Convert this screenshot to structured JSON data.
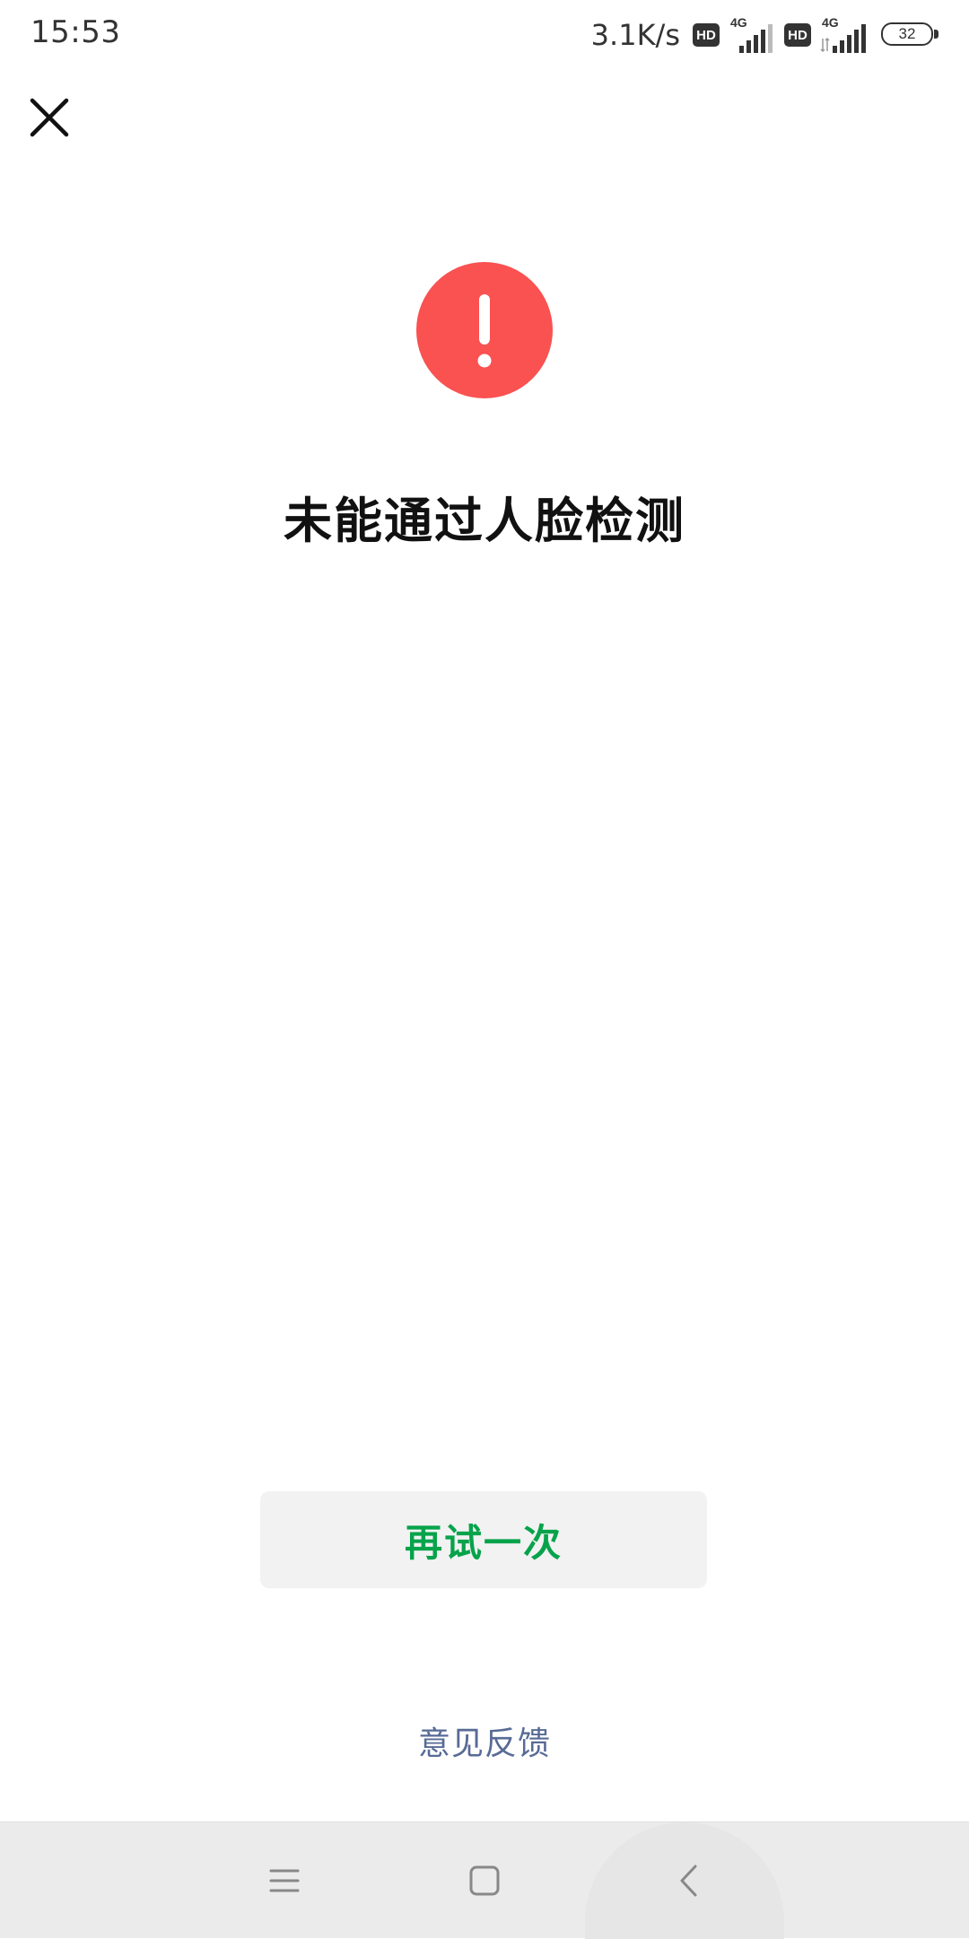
{
  "status_bar": {
    "time": "15:53",
    "net_speed": "3.1K/s",
    "hd_label": "HD",
    "network_label": "4G",
    "battery_level": "32"
  },
  "header": {
    "close_icon": "close-icon"
  },
  "result": {
    "icon": "exclamation-circle-icon",
    "icon_color": "#fa5151",
    "title": "未能通过人脸检测"
  },
  "actions": {
    "retry_label": "再试一次",
    "retry_color": "#07a34b",
    "feedback_label": "意见反馈",
    "feedback_color": "#576b95"
  },
  "nav_bar": {
    "menu_icon": "menu-icon",
    "home_icon": "home-square-icon",
    "back_icon": "back-chevron-icon"
  }
}
